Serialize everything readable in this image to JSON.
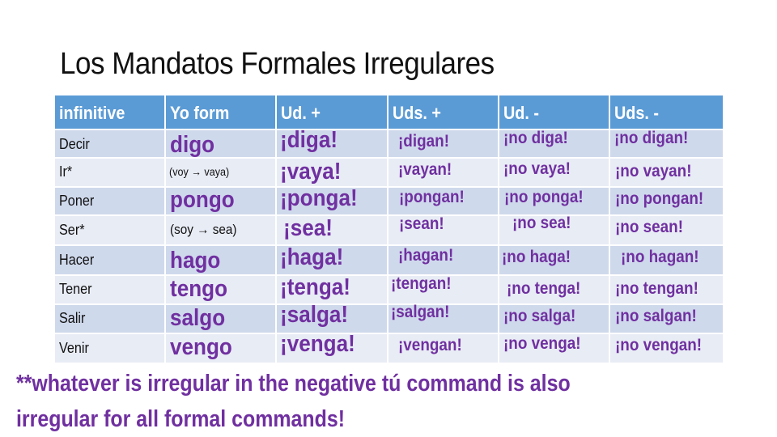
{
  "title": "Los Mandatos Formales Irregulares",
  "table": {
    "headers": [
      "infinitive",
      "Yo form",
      "Ud. +",
      "Uds. +",
      "Ud. -",
      "Uds. -"
    ],
    "rows": [
      {
        "infinitive": "Decir",
        "yo": "digo",
        "ud_pos": "¡diga!",
        "uds_pos": "¡digan!",
        "ud_neg": "¡no diga!",
        "uds_neg": "¡no digan!"
      },
      {
        "infinitive": "Ir*",
        "yo": "(voy → vaya)",
        "ud_pos": "¡vaya!",
        "uds_pos": "¡vayan!",
        "ud_neg": "¡no vaya!",
        "uds_neg": "¡no vayan!"
      },
      {
        "infinitive": "Poner",
        "yo": "pongo",
        "ud_pos": "¡ponga!",
        "uds_pos": "¡pongan!",
        "ud_neg": "¡no ponga!",
        "uds_neg": "¡no pongan!"
      },
      {
        "infinitive": "Ser*",
        "yo": "(soy → sea)",
        "ud_pos": "¡sea!",
        "uds_pos": "¡sean!",
        "ud_neg": "¡no sea!",
        "uds_neg": "¡no sean!"
      },
      {
        "infinitive": "Hacer",
        "yo": "hago",
        "ud_pos": "¡haga!",
        "uds_pos": "¡hagan!",
        "ud_neg": "¡no haga!",
        "uds_neg": "¡no hagan!"
      },
      {
        "infinitive": "Tener",
        "yo": "tengo",
        "ud_pos": "¡tenga!",
        "uds_pos": "¡tengan!",
        "ud_neg": "¡no tenga!",
        "uds_neg": "¡no tengan!"
      },
      {
        "infinitive": "Salir",
        "yo": "salgo",
        "ud_pos": "¡salga!",
        "uds_pos": "¡salgan!",
        "ud_neg": "¡no salga!",
        "uds_neg": "¡no salgan!"
      },
      {
        "infinitive": "Venir",
        "yo": "vengo",
        "ud_pos": "¡venga!",
        "uds_pos": "¡vengan!",
        "ud_neg": "¡no venga!",
        "uds_neg": "¡no vengan!"
      }
    ]
  },
  "note": {
    "line1": "**whatever is irregular in the negative tú command is also",
    "line2": "irregular for all formal commands!"
  },
  "colors": {
    "header_bg": "#5b9bd5",
    "row_odd_bg": "#cfd9ec",
    "row_even_bg": "#e8ecf5",
    "accent_purple": "#7030a0"
  }
}
